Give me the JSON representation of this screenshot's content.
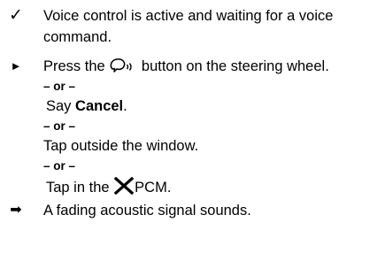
{
  "symbols": {
    "check": "✓",
    "step": "►",
    "result": "➡"
  },
  "icons": {
    "voice_button": "voice-control-steering-wheel-icon",
    "close": "close-x-icon"
  },
  "items": {
    "prereq_line1": "Voice control is active and waiting for a voice",
    "prereq_line2": "command.",
    "step_pre": "Press the",
    "step_post": "button on the steering wheel.",
    "or_label": "– or –",
    "say_pre": "Say ",
    "say_bold": "Cancel",
    "say_post": ".",
    "tap_outside": "Tap outside the window.",
    "tap_in_pre": "Tap in the",
    "tap_in_post": "PCM.",
    "result": "A fading acoustic signal sounds."
  }
}
